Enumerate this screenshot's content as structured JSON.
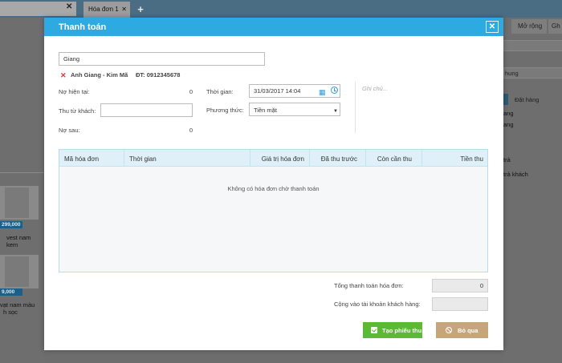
{
  "background": {
    "tab": {
      "label": "Hóa đơn 1",
      "close": "✕",
      "add": "+"
    },
    "search_close": "✕",
    "products": [
      {
        "price": "299,000",
        "name_line1": "vest nam",
        "name_line2": "kem"
      },
      {
        "price": "9,000",
        "name_line1": "vạt nam màu",
        "name_line2": "h sọc"
      }
    ],
    "right_panel": {
      "tabs": [
        "Mở rộng",
        "Gh"
      ],
      "field1": "",
      "field2": "hung",
      "tab_active": "Đặt hàng",
      "text1": "ang",
      "text2": "ang",
      "text3": "trả",
      "text4": "trả khách"
    }
  },
  "modal": {
    "title": "Thanh toán",
    "close_label": "✕",
    "customer": {
      "name": "Giang",
      "remove_icon": "✕",
      "address": "Anh Giang - Kim Mã",
      "phone": "ĐT: 0912345678"
    },
    "debt_now": {
      "label": "Nợ hiện tại:",
      "value": "0"
    },
    "collect": {
      "label": "Thu từ khách:",
      "value": ""
    },
    "debt_after": {
      "label": "Nợ sau:",
      "value": "0"
    },
    "time": {
      "label": "Thời gian:",
      "value": "31/03/2017 14:04"
    },
    "method": {
      "label": "Phương thức:",
      "value": "Tiền mặt"
    },
    "note_placeholder": "Ghi chú...",
    "table": {
      "columns": [
        "Mã hóa đơn",
        "Thời gian",
        "Giá trị hóa đơn",
        "Đã thu trước",
        "Còn cần thu",
        "Tiền thu"
      ],
      "empty_text": "Không có hóa đơn chờ thanh toán"
    },
    "total_payment": {
      "label": "Tổng thanh toán hóa đơn:",
      "value": "0"
    },
    "add_to_account": {
      "label": "Cộng vào tài khoản khách hàng:",
      "value": ""
    },
    "buttons": {
      "create": "Tạo phiếu thu",
      "skip": "Bỏ qua"
    }
  },
  "colors": {
    "header": "#2daae2",
    "primary_button": "#5cb933",
    "secondary_button": "#c7a57b",
    "remove_icon": "#d9363e"
  },
  "icons": [
    "close-icon",
    "remove-customer-icon",
    "calendar-icon",
    "clock-icon",
    "dropdown-arrow-icon",
    "checkbox-icon",
    "ban-icon"
  ]
}
